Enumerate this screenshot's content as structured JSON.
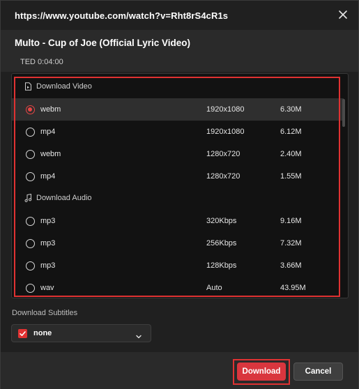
{
  "window": {
    "url": "https://www.youtube.com/watch?v=Rht8rS4cR1s"
  },
  "video": {
    "title": "Multo - Cup of Joe (Official Lyric Video)",
    "meta": "TED 0:04:00"
  },
  "sections": {
    "video_label": "Download Video",
    "audio_label": "Download Audio"
  },
  "video_options": [
    {
      "format": "webm",
      "resolution": "1920x1080",
      "size": "6.30M",
      "selected": true
    },
    {
      "format": "mp4",
      "resolution": "1920x1080",
      "size": "6.12M",
      "selected": false
    },
    {
      "format": "webm",
      "resolution": "1280x720",
      "size": "2.40M",
      "selected": false
    },
    {
      "format": "mp4",
      "resolution": "1280x720",
      "size": "1.55M",
      "selected": false
    }
  ],
  "audio_options": [
    {
      "format": "mp3",
      "bitrate": "320Kbps",
      "size": "9.16M",
      "selected": false
    },
    {
      "format": "mp3",
      "bitrate": "256Kbps",
      "size": "7.32M",
      "selected": false
    },
    {
      "format": "mp3",
      "bitrate": "128Kbps",
      "size": "3.66M",
      "selected": false
    },
    {
      "format": "wav",
      "bitrate": "Auto",
      "size": "43.95M",
      "selected": false
    }
  ],
  "subtitles": {
    "label": "Download Subtitles",
    "value": "none",
    "checked": true
  },
  "footer": {
    "download_label": "Download",
    "cancel_label": "Cancel"
  },
  "colors": {
    "accent": "#d9363e",
    "highlight": "#e03232"
  }
}
